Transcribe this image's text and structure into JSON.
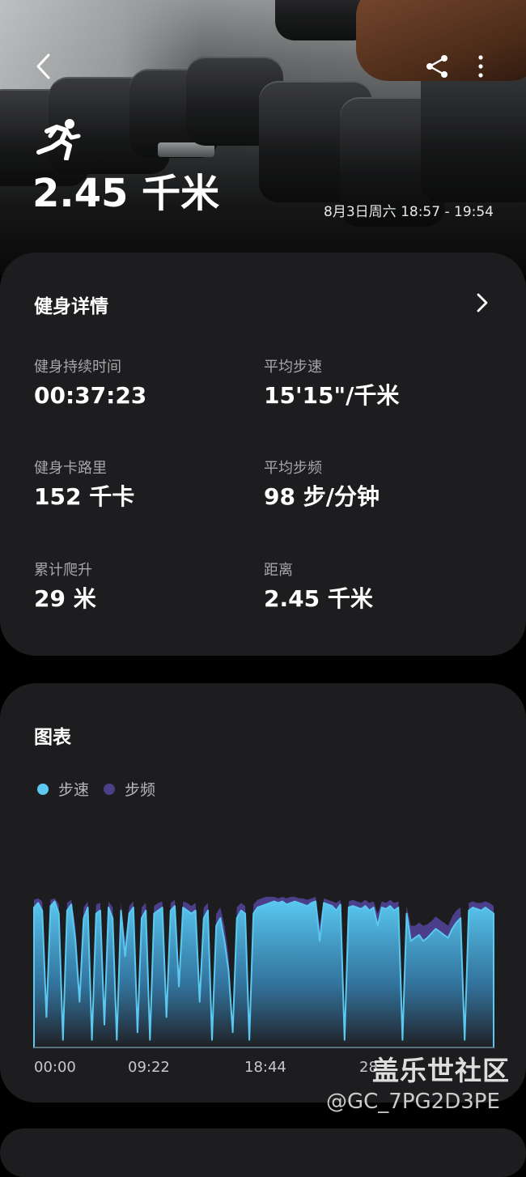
{
  "header": {
    "activity_icon": "running-icon",
    "distance": "2.45 千米",
    "time_range": "8月3日周六 18:57 - 19:54"
  },
  "toolbar": {
    "back_icon": "chevron-left-icon",
    "share_icon": "share-icon",
    "more_icon": "more-vertical-icon"
  },
  "details": {
    "title": "健身详情",
    "stats": [
      {
        "label": "健身持续时间",
        "value": "00:37:23"
      },
      {
        "label": "平均步速",
        "value": "15'15\"/千米"
      },
      {
        "label": "健身卡路里",
        "value": "152 千卡"
      },
      {
        "label": "平均步频",
        "value": "98 步/分钟"
      },
      {
        "label": "累计爬升",
        "value": "29 米"
      },
      {
        "label": "距离",
        "value": "2.45 千米"
      }
    ]
  },
  "chart": {
    "title": "图表",
    "legend": [
      {
        "name": "步速",
        "color": "#5ac8f0"
      },
      {
        "name": "步频",
        "color": "#4b3f8a"
      }
    ],
    "x_ticks": [
      "00:00",
      "09:22",
      "18:44",
      "28"
    ]
  },
  "chart_data": {
    "type": "area",
    "title": "图表",
    "xlabel": "",
    "ylabel": "",
    "x_ticks": [
      "00:00",
      "09:22",
      "18:44",
      "28"
    ],
    "x_range_minutes": [
      0,
      37.4
    ],
    "series": [
      {
        "name": "步速",
        "color": "#5ac8f0",
        "values": [
          0.92,
          0.95,
          0.9,
          0.2,
          0.93,
          0.96,
          0.88,
          0.05,
          0.9,
          0.94,
          0.7,
          0.3,
          0.85,
          0.92,
          0.05,
          0.88,
          0.9,
          0.15,
          0.92,
          0.85,
          0.05,
          0.9,
          0.6,
          0.88,
          0.92,
          0.1,
          0.85,
          0.9,
          0.05,
          0.88,
          0.9,
          0.92,
          0.2,
          0.9,
          0.93,
          0.4,
          0.92,
          0.9,
          0.88,
          0.9,
          0.3,
          0.85,
          0.9,
          0.05,
          0.8,
          0.85,
          0.7,
          0.5,
          0.1,
          0.85,
          0.9,
          0.88,
          0.05,
          0.88,
          0.92,
          0.93,
          0.94,
          0.95,
          0.96,
          0.95,
          0.96,
          0.94,
          0.95,
          0.96,
          0.95,
          0.94,
          0.93,
          0.95,
          0.96,
          0.7,
          0.95,
          0.94,
          0.93,
          0.9,
          0.94,
          0.05,
          0.92,
          0.93,
          0.92,
          0.91,
          0.93,
          0.9,
          0.92,
          0.8,
          0.92,
          0.91,
          0.93,
          0.9,
          0.92,
          0.05,
          0.88,
          0.7,
          0.72,
          0.74,
          0.7,
          0.72,
          0.75,
          0.78,
          0.76,
          0.74,
          0.72,
          0.78,
          0.82,
          0.85,
          0.05,
          0.9,
          0.92,
          0.91,
          0.9,
          0.92,
          0.9,
          0.88
        ]
      },
      {
        "name": "步频",
        "color": "#4b3f8a",
        "values": [
          0.97,
          0.98,
          0.96,
          0.3,
          0.97,
          0.98,
          0.94,
          0.1,
          0.95,
          0.97,
          0.8,
          0.4,
          0.92,
          0.96,
          0.1,
          0.94,
          0.95,
          0.25,
          0.96,
          0.92,
          0.1,
          0.95,
          0.7,
          0.93,
          0.96,
          0.15,
          0.92,
          0.95,
          0.1,
          0.93,
          0.95,
          0.96,
          0.3,
          0.95,
          0.97,
          0.5,
          0.96,
          0.95,
          0.93,
          0.95,
          0.4,
          0.92,
          0.95,
          0.1,
          0.88,
          0.92,
          0.8,
          0.6,
          0.15,
          0.92,
          0.95,
          0.93,
          0.1,
          0.94,
          0.97,
          0.98,
          0.99,
          0.99,
          0.99,
          0.98,
          0.99,
          0.98,
          0.99,
          0.99,
          0.98,
          0.98,
          0.97,
          0.98,
          0.99,
          0.8,
          0.98,
          0.97,
          0.96,
          0.95,
          0.97,
          0.1,
          0.96,
          0.97,
          0.96,
          0.95,
          0.97,
          0.95,
          0.96,
          0.88,
          0.96,
          0.95,
          0.97,
          0.95,
          0.96,
          0.1,
          0.93,
          0.8,
          0.8,
          0.82,
          0.8,
          0.81,
          0.83,
          0.86,
          0.84,
          0.82,
          0.8,
          0.86,
          0.9,
          0.92,
          0.1,
          0.95,
          0.96,
          0.95,
          0.95,
          0.96,
          0.95,
          0.93
        ]
      }
    ],
    "grid": false,
    "legend_position": "top-left"
  },
  "watermark": {
    "site": "盖乐世社区",
    "user": "@GC_7PG2D3PE"
  }
}
